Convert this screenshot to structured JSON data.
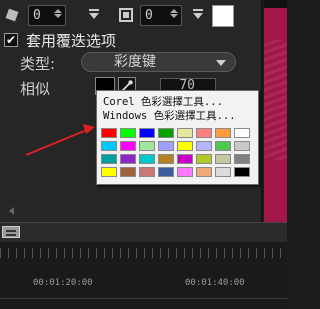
{
  "toolbar": {
    "rotate_value": "0",
    "border_value": "0"
  },
  "overlay_checkbox": {
    "label": "套用覆迭选项",
    "checked": true,
    "mark": "✔"
  },
  "type_field": {
    "label": "类型:",
    "value": "彩度键"
  },
  "similarity": {
    "label": "相似",
    "value": "70"
  },
  "color_menu": {
    "items": [
      "Corel 色彩選擇工具...",
      "Windows 色彩選擇工具..."
    ],
    "swatch_rows": [
      [
        "#ff0000",
        "#00ff00",
        "#0000ff",
        "#00a000",
        "#e6e6a0",
        "#ff8080",
        "#ff9b3c",
        "#ffffff"
      ],
      [
        "#00c8ff",
        "#ff00ff",
        "#a0e6a0",
        "#a0a0ff",
        "#ffff00",
        "#b4b4ff",
        "#50c850",
        "#c8c8c8"
      ],
      [
        "#00a0a0",
        "#8c28c8",
        "#00c8c8",
        "#b4821e",
        "#c800c8",
        "#b4c828",
        "#c8c8a0",
        "#808080"
      ],
      [
        "#ffff00",
        "#a0643c",
        "#c87878",
        "#3c5aa0",
        "#ff78ff",
        "#f0aa78",
        "#dcdcdc",
        "#000000"
      ]
    ]
  },
  "timeline": {
    "timecodes": [
      "00:01:20:00",
      "00:01:40:00"
    ]
  },
  "colors": {
    "preview": "#a3164a",
    "annotation_arrow": "#e02020"
  }
}
